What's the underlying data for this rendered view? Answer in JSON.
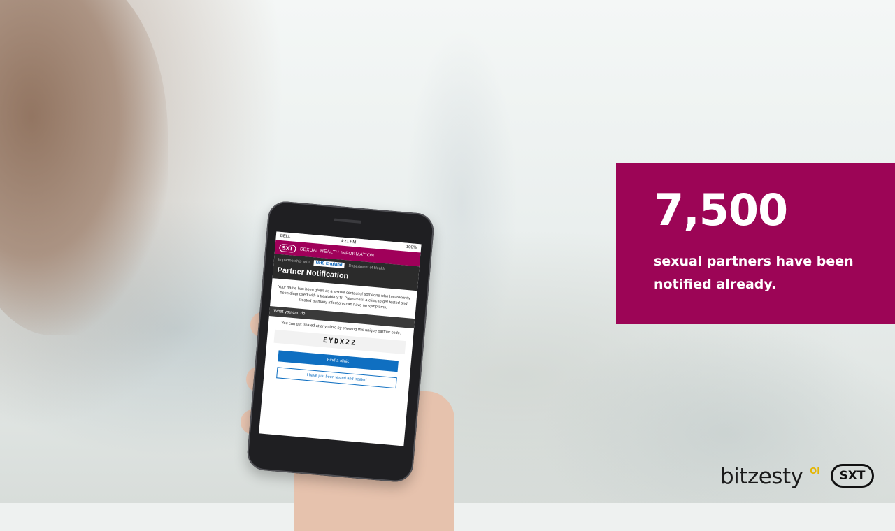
{
  "stat": {
    "number": "7,500",
    "caption": "sexual partners have been notified already."
  },
  "phone": {
    "status_carrier": "BELL",
    "status_time": "4:21 PM",
    "status_battery": "100%",
    "header_logo": "SXT",
    "header_title": "SEXUAL HEALTH INFORMATION",
    "partnership_label": "In partnership with",
    "nhs_label": "NHS England",
    "dept_label": "Department of Health",
    "page_title": "Partner Notification",
    "notice_text": "Your name has been given as a sexual contact of someone who has recently been diagnosed with a treatable STI. Please visit a clinic to get tested and treated as many infections can have no symptoms.",
    "section_title": "What you can do",
    "instruction_text": "You can get treated at any clinic by showing this unique partner code.",
    "partner_code": "EYDX22",
    "find_clinic_button": "Find a clinic",
    "tested_button": "I have just been tested and treated"
  },
  "brands": {
    "bitzesty": "bitzesty",
    "bitzesty_sup": "OI",
    "sxt": "SXT"
  },
  "colors": {
    "accent": "#9c0556",
    "sxt_bar": "#a0005a",
    "button_blue": "#0f6fc1"
  }
}
